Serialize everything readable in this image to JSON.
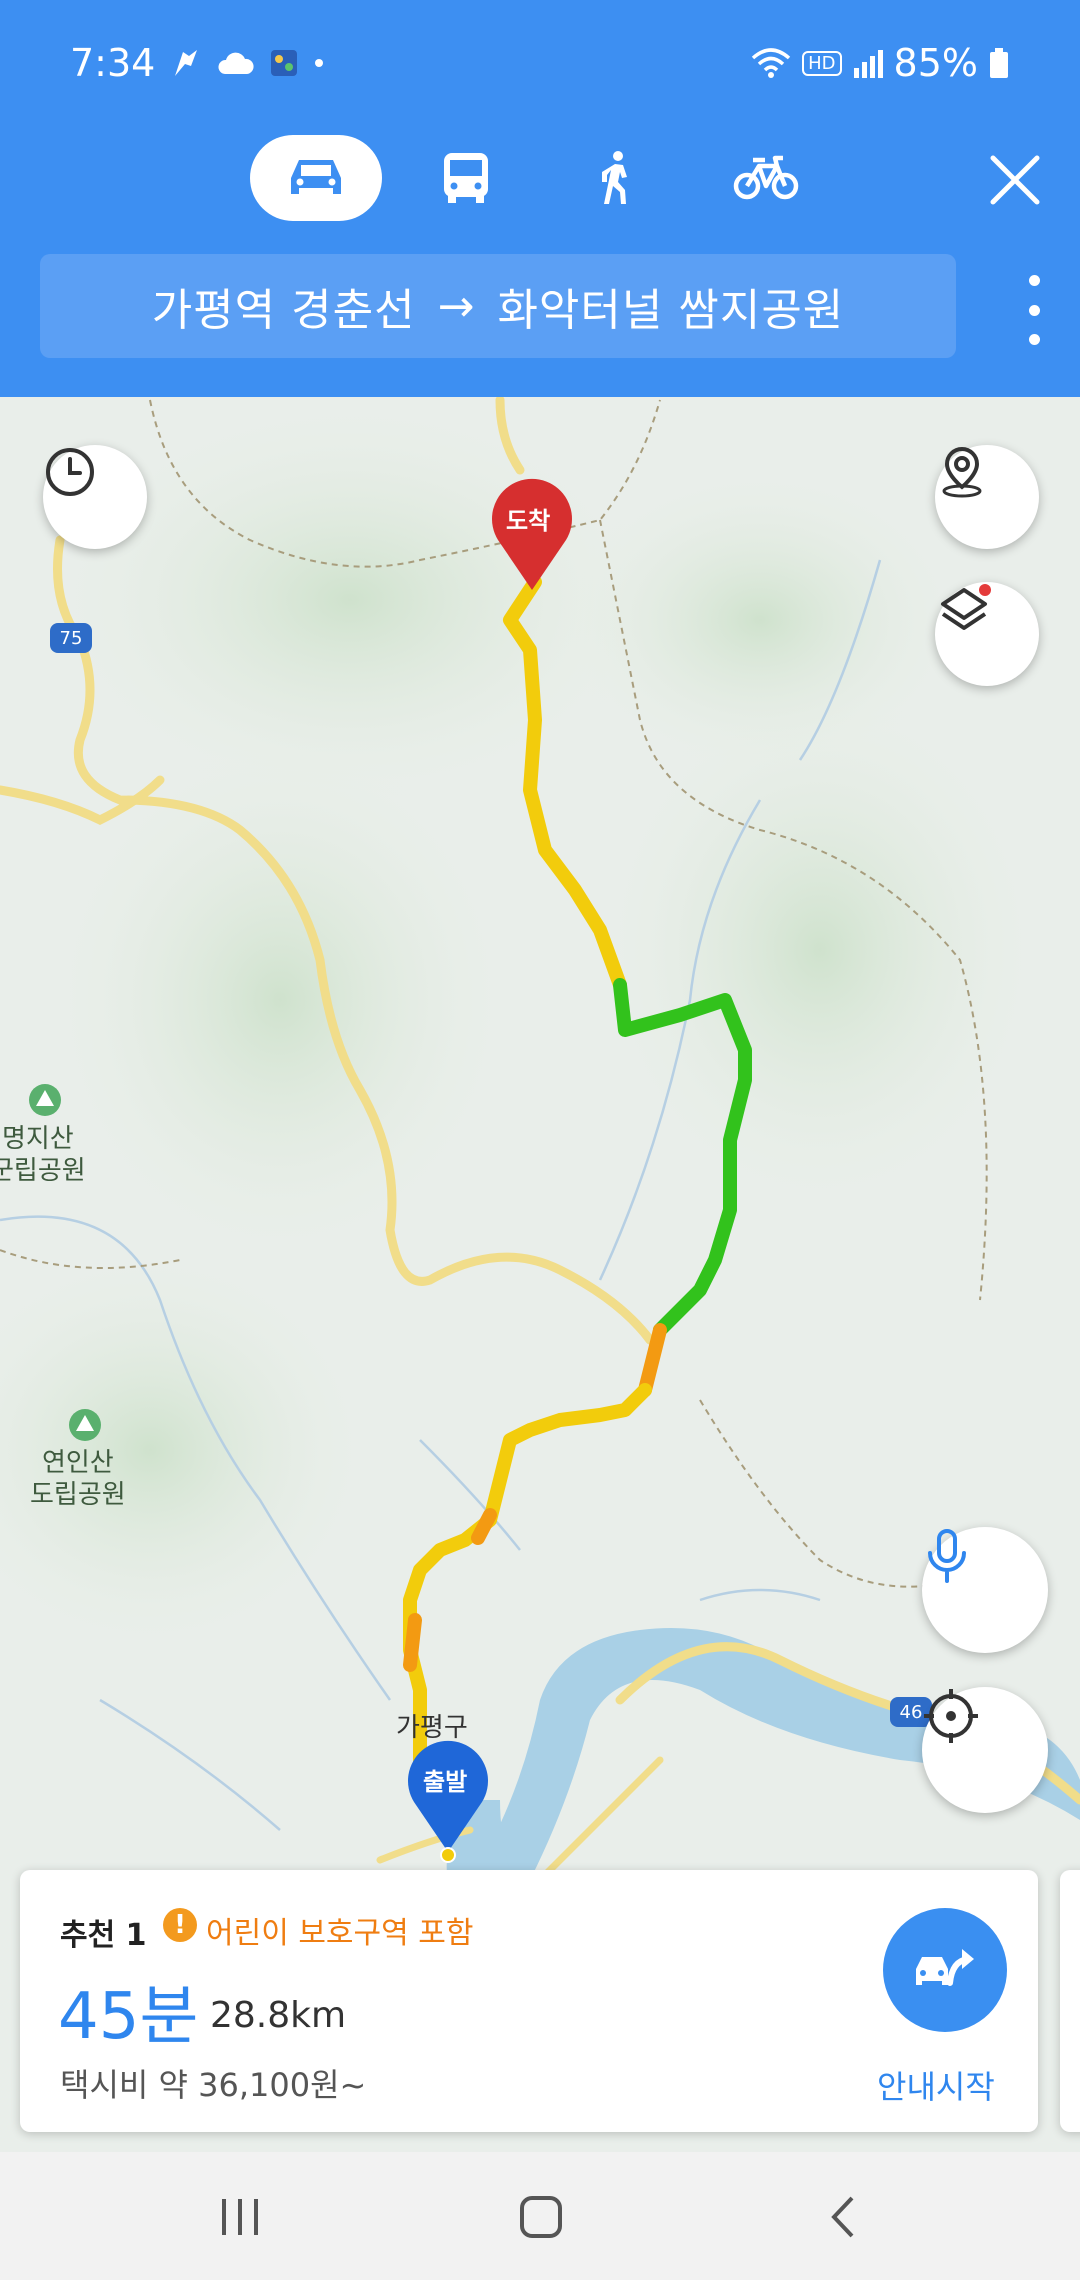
{
  "status_bar": {
    "time": "7:34",
    "battery": "85%",
    "hd_label": "HD"
  },
  "modes": [
    {
      "name": "car",
      "active": true
    },
    {
      "name": "bus",
      "active": false
    },
    {
      "name": "walk",
      "active": false
    },
    {
      "name": "bike",
      "active": false
    }
  ],
  "route": {
    "origin": "가평역 경춘선",
    "arrow": "→",
    "destination": "화악터널 쌈지공원"
  },
  "map": {
    "end_pin": "도착",
    "start_pin": "출발",
    "town": "가평구",
    "road_75": "75",
    "road_46": "46",
    "poi_1": "명지산\n군립공원",
    "poi_2": "연인산\n도립공원"
  },
  "result": {
    "rank": "추천 1",
    "warning_icon": "!",
    "warning": "어린이 보호구역 포함",
    "duration": "45분",
    "distance": "28.8km",
    "taxi_fare": "택시비 약 36,100원~",
    "start_label": "안내시작"
  },
  "colors": {
    "header": "#3d8ff2",
    "accent": "#2f86ee",
    "warning": "#ef7d11",
    "route_yellow": "#f2cc0c",
    "route_green": "#32c21c",
    "route_orange": "#f39a12"
  }
}
